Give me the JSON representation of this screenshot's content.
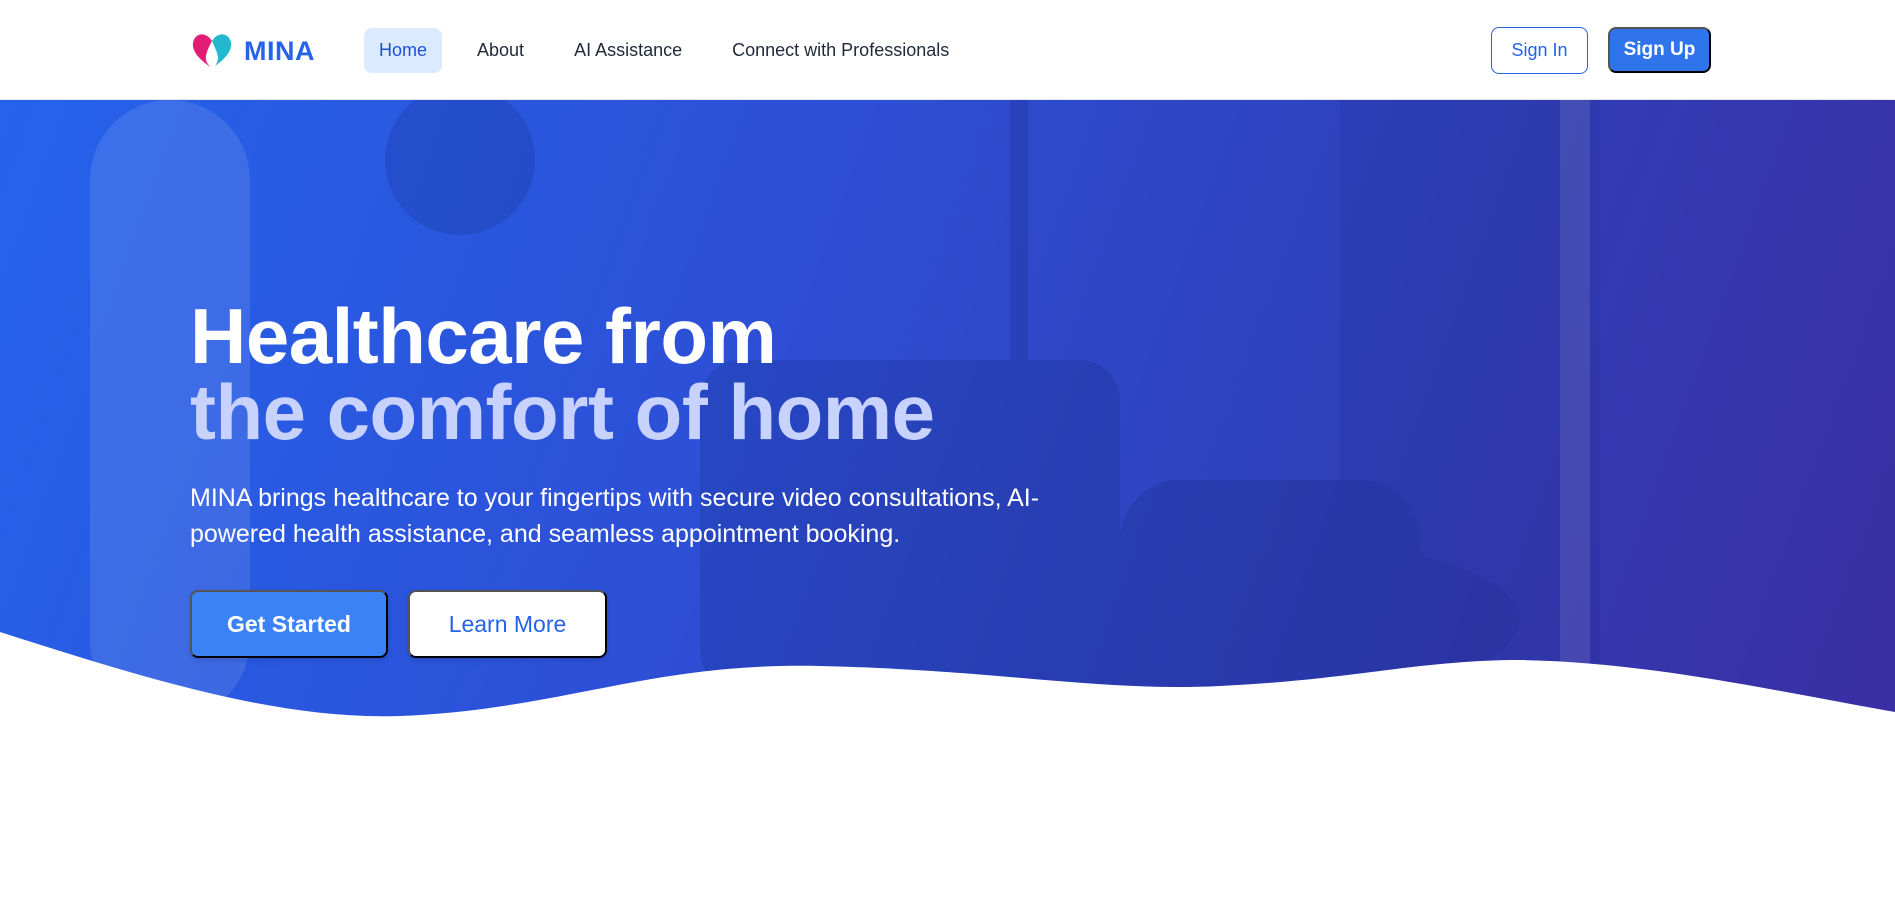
{
  "brand": {
    "name": "MINA",
    "logo_icon": "heart-logo-icon"
  },
  "nav": {
    "items": [
      {
        "label": "Home",
        "active": true
      },
      {
        "label": "About",
        "active": false
      },
      {
        "label": "AI Assistance",
        "active": false
      },
      {
        "label": "Connect with Professionals",
        "active": false
      }
    ]
  },
  "auth": {
    "sign_in": "Sign In",
    "sign_up": "Sign Up"
  },
  "hero": {
    "title_line1": "Healthcare from",
    "title_line2": "the comfort of home",
    "subtitle": "MINA brings healthcare to your fingertips with secure video consultations, AI-powered health assistance, and seamless appointment booking.",
    "primary_cta": "Get Started",
    "secondary_cta": "Learn More"
  },
  "colors": {
    "brand_blue": "#2563eb",
    "nav_active_bg": "#dbeafe",
    "hero_gradient_start": "#2563eb",
    "hero_gradient_end": "#3b2ea3",
    "title_accent": "#c7d2fe"
  }
}
